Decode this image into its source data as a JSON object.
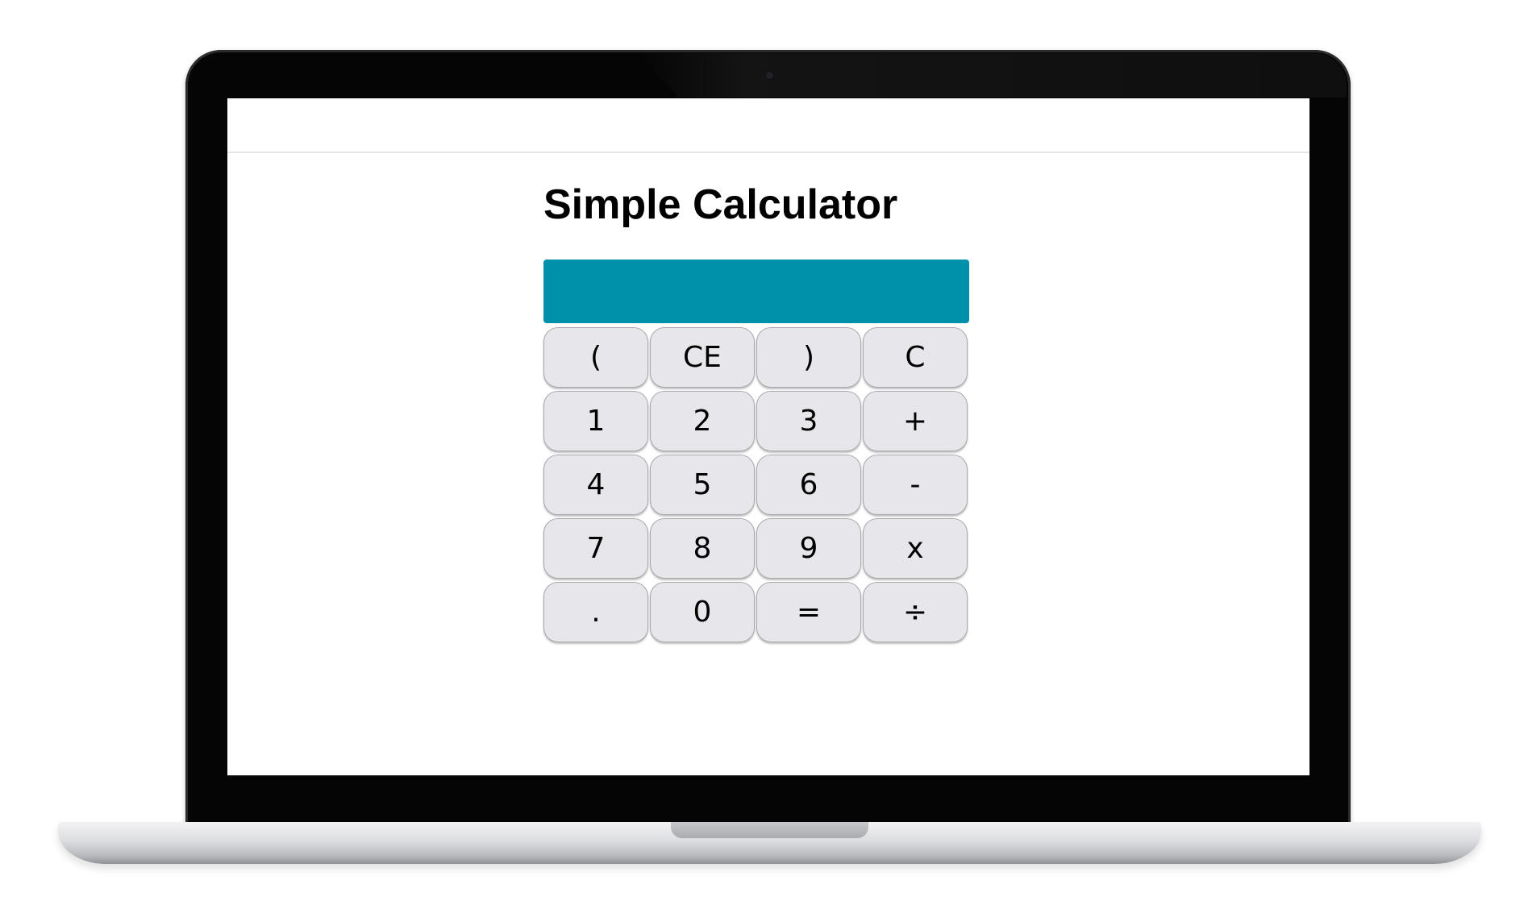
{
  "page": {
    "title": "Simple Calculator"
  },
  "display": {
    "value": ""
  },
  "keypad": {
    "keys": [
      {
        "label": "(",
        "name": "open-paren-button"
      },
      {
        "label": "CE",
        "name": "clear-entry-button"
      },
      {
        "label": ")",
        "name": "close-paren-button"
      },
      {
        "label": "C",
        "name": "clear-button"
      },
      {
        "label": "1",
        "name": "digit-1-button"
      },
      {
        "label": "2",
        "name": "digit-2-button"
      },
      {
        "label": "3",
        "name": "digit-3-button"
      },
      {
        "label": "+",
        "name": "add-button"
      },
      {
        "label": "4",
        "name": "digit-4-button"
      },
      {
        "label": "5",
        "name": "digit-5-button"
      },
      {
        "label": "6",
        "name": "digit-6-button"
      },
      {
        "label": "-",
        "name": "subtract-button"
      },
      {
        "label": "7",
        "name": "digit-7-button"
      },
      {
        "label": "8",
        "name": "digit-8-button"
      },
      {
        "label": "9",
        "name": "digit-9-button"
      },
      {
        "label": "x",
        "name": "multiply-button"
      },
      {
        "label": ".",
        "name": "decimal-button"
      },
      {
        "label": "0",
        "name": "digit-0-button"
      },
      {
        "label": "=",
        "name": "equals-button"
      },
      {
        "label": "÷",
        "name": "divide-button"
      }
    ]
  },
  "colors": {
    "display_background": "#0091aa",
    "key_background": "#e7e6ea",
    "laptop_bezel": "#050505"
  }
}
